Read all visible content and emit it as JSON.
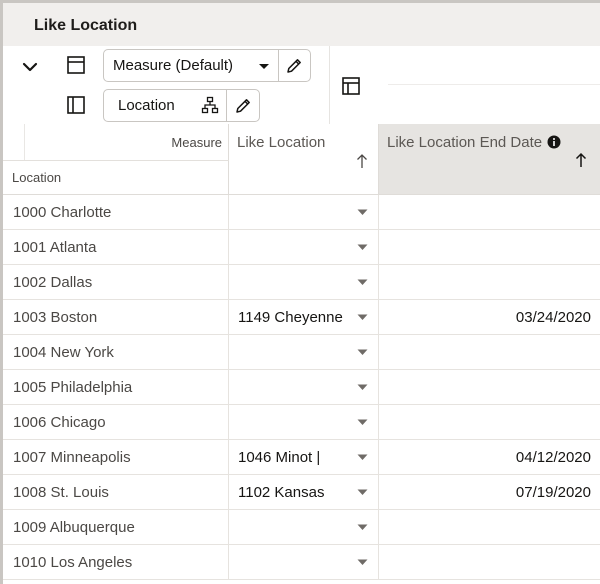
{
  "header": {
    "title": "Like Location"
  },
  "toolbar": {
    "collapse_icon": "chevron-down-icon",
    "row_icon": "row-layout-icon",
    "column_icon": "column-layout-icon",
    "measure_pill": {
      "label": "Measure (Default)",
      "icons": [
        "caret-down-icon",
        "pencil-icon"
      ]
    },
    "location_pill": {
      "label": "Location",
      "icons": [
        "hierarchy-icon",
        "pencil-icon"
      ]
    },
    "layout_icon": "pivot-layout-icon"
  },
  "grid": {
    "corner_top_label": "Measure",
    "corner_bottom_label": "Location",
    "columns": [
      {
        "label": "Like Location",
        "sort_icon": "arrow-up-icon"
      },
      {
        "label": "Like Location End Date",
        "info_icon": "info-icon",
        "sort_icon": "arrow-up-icon"
      }
    ],
    "rows": [
      {
        "location": "1000 Charlotte",
        "like_location": "",
        "end_date": ""
      },
      {
        "location": "1001 Atlanta",
        "like_location": "",
        "end_date": ""
      },
      {
        "location": "1002 Dallas",
        "like_location": "",
        "end_date": ""
      },
      {
        "location": "1003 Boston",
        "like_location": "1149 Cheyenne",
        "end_date": "03/24/2020"
      },
      {
        "location": "1004 New York",
        "like_location": "",
        "end_date": ""
      },
      {
        "location": "1005 Philadelphia",
        "like_location": "",
        "end_date": ""
      },
      {
        "location": "1006 Chicago",
        "like_location": "",
        "end_date": ""
      },
      {
        "location": "1007 Minneapolis",
        "like_location": "1046 Minot |",
        "end_date": "04/12/2020"
      },
      {
        "location": "1008 St. Louis",
        "like_location": "1102 Kansas",
        "end_date": "07/19/2020"
      },
      {
        "location": "1009 Albuquerque",
        "like_location": "",
        "end_date": ""
      },
      {
        "location": "1010 Los Angeles",
        "like_location": "",
        "end_date": ""
      }
    ]
  },
  "colors": {
    "title_bar_bg": "#f1efed",
    "selected_header_bg": "#e6e4e1",
    "border": "#dfdcd8",
    "text": "#161513"
  }
}
